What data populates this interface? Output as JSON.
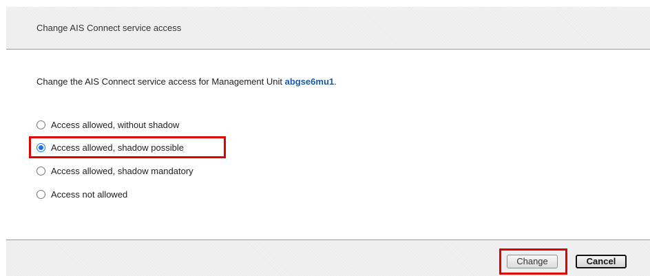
{
  "dialog": {
    "title": "Change AIS Connect service access",
    "intro_prefix": "Change the AIS Connect service access for Management Unit ",
    "unit_name": "abgse6mu1",
    "intro_suffix": "."
  },
  "options": [
    {
      "label": "Access allowed, without shadow",
      "selected": false
    },
    {
      "label": "Access allowed, shadow possible",
      "selected": true
    },
    {
      "label": "Access allowed, shadow mandatory",
      "selected": false
    },
    {
      "label": "Access not allowed",
      "selected": false
    }
  ],
  "buttons": {
    "change_label": "Change",
    "cancel_label": "Cancel"
  },
  "colors": {
    "unit_name": "#1a5aa8",
    "radio_selected": "#1a73e8",
    "highlight": "#e00000",
    "panel_background": "#f1f1f1"
  },
  "annotations": {
    "highlighted_elements": [
      "option-shadow-possible",
      "change-button"
    ]
  }
}
